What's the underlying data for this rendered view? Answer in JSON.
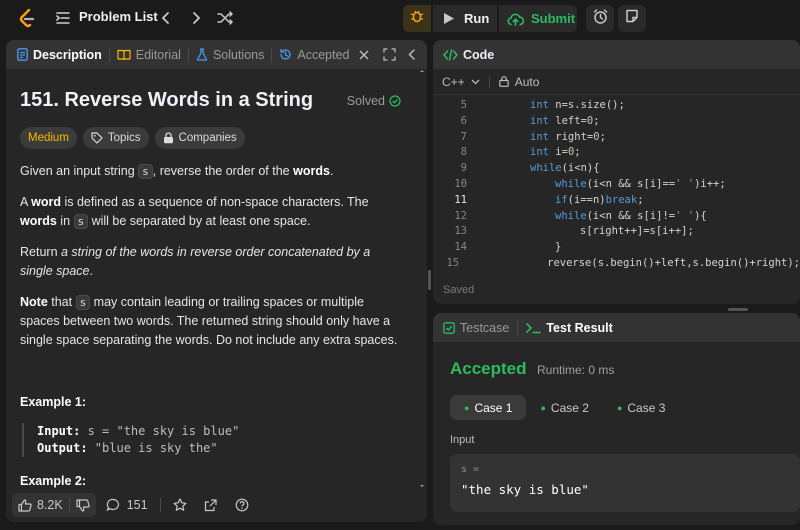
{
  "topbar": {
    "problem_list_label": "Problem List",
    "run_label": "Run",
    "submit_label": "Submit"
  },
  "left": {
    "tabs": [
      {
        "label": "Description"
      },
      {
        "label": "Editorial"
      },
      {
        "label": "Solutions"
      },
      {
        "label": "Accepted"
      }
    ],
    "title": "151. Reverse Words in a String",
    "solved_label": "Solved",
    "pills": {
      "difficulty": "Medium",
      "topics": "Topics",
      "companies": "Companies"
    },
    "p1": {
      "a": "Given an input string ",
      "code": "s",
      "b": ", reverse the order of the ",
      "bold": "words",
      "c": "."
    },
    "p2": {
      "a": "A ",
      "bold1": "word",
      "b": " is defined as a sequence of non-space characters. The ",
      "bold2": "words",
      "c": " in ",
      "code": "s",
      "d": " will be separated by at least one space."
    },
    "p3": {
      "a": "Return ",
      "italic": "a string of the words in reverse order concatenated by a single space",
      "b": "."
    },
    "p4": {
      "bold": "Note",
      "a": " that ",
      "code": "s",
      "b": " may contain leading or trailing spaces or multiple spaces between two words. The returned string should only have a single space separating the words. Do not include any extra spaces."
    },
    "example1_title": "Example 1:",
    "example1": {
      "input_label": "Input:",
      "input_value": " s = \"the sky is blue\"",
      "output_label": "Output:",
      "output_value": " \"blue is sky the\""
    },
    "example2_title": "Example 2:",
    "bottom": {
      "likes": "8.2K",
      "comments": "151"
    }
  },
  "code_panel": {
    "header": "Code",
    "language": "C++",
    "autosave": "Auto",
    "saved_label": "Saved",
    "lines": [
      {
        "n": "5",
        "indent": 0,
        "text": "int n=s.size();"
      },
      {
        "n": "6",
        "indent": 0,
        "text": "int left=0;"
      },
      {
        "n": "7",
        "indent": 0,
        "text": "int right=0;"
      },
      {
        "n": "8",
        "indent": 0,
        "text": "int i=0;"
      },
      {
        "n": "9",
        "indent": 0,
        "text": "while(i<n){"
      },
      {
        "n": "10",
        "indent": 1,
        "text": "while(i<n && s[i]==' ')i++;"
      },
      {
        "n": "11",
        "indent": 1,
        "text": "if(i==n)break;"
      },
      {
        "n": "12",
        "indent": 1,
        "text": "while(i<n && s[i]!=' '){"
      },
      {
        "n": "13",
        "indent": 2,
        "text": "s[right++]=s[i++];"
      },
      {
        "n": "14",
        "indent": 1,
        "text": "}"
      },
      {
        "n": "15",
        "indent": 1,
        "text": "reverse(s.begin()+left,s.begin()+right);"
      }
    ],
    "active_line": "11"
  },
  "result_panel": {
    "tab_testcase": "Testcase",
    "tab_result": "Test Result",
    "status": "Accepted",
    "runtime": "Runtime: 0 ms",
    "cases": [
      "Case 1",
      "Case 2",
      "Case 3"
    ],
    "input_label": "Input",
    "input_key": "s =",
    "input_value": "\"the sky is blue\""
  },
  "colors": {
    "accent_green": "#2cbb5d",
    "medium": "#ffb800",
    "bg": "#1a1a1a",
    "panel": "#262626"
  }
}
